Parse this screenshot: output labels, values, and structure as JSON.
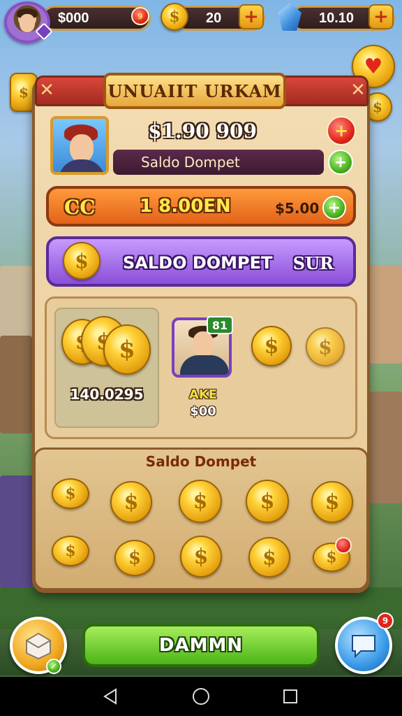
{
  "topbar": {
    "cash": "$000",
    "cash_count": "9",
    "coins": "20",
    "gems": "10.10"
  },
  "panel": {
    "title": "UNUAIIT URKAM",
    "close_glyph": "✕"
  },
  "profile": {
    "balance": "$1.90 909",
    "wallet_label": "Saldo Dompet"
  },
  "offer_bar": {
    "left_text": "CC",
    "mid_text": "1 8.00EN",
    "price": "$5.00"
  },
  "wallet_bar": {
    "label": "SALDO DOMPET",
    "suffix": "SUR"
  },
  "showcase": {
    "total": "140.0295",
    "character_badge": "81",
    "character_name": "AKE",
    "character_price": "$00"
  },
  "wallet_section": {
    "title": "Saldo Dompet"
  },
  "cta": {
    "label": "DAMMN"
  },
  "notifications": {
    "chat_count": "9"
  },
  "icons": {
    "coin": "dollar-coin-icon",
    "gem": "blue-gem-icon",
    "plus": "plus-icon",
    "chat": "chat-bubble-icon",
    "back": "back-triangle-icon",
    "home": "home-circle-icon",
    "recents": "recents-square-icon"
  },
  "colors": {
    "accent_purple": "#8a4fd8",
    "accent_orange": "#e2621a",
    "accent_green": "#4cb418",
    "panel_bg": "#f3ddb3",
    "header_red": "#c33a2e"
  }
}
